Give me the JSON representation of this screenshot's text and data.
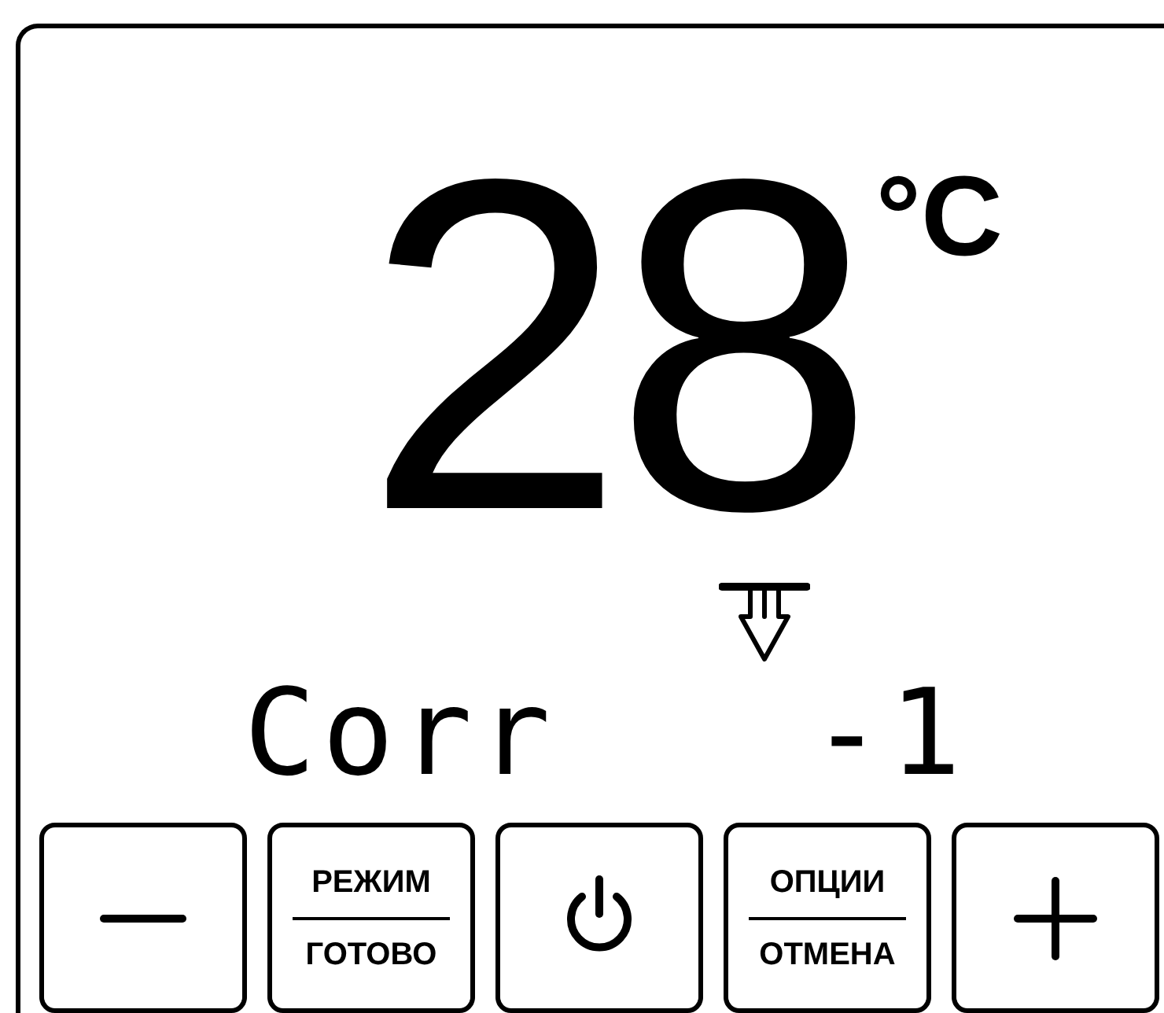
{
  "temperature": {
    "value": "28",
    "unit": "°C"
  },
  "status_line": {
    "label": "Corr",
    "value": "-1"
  },
  "buttons": [
    {
      "kind": "minus"
    },
    {
      "kind": "dual",
      "top": "РЕЖИМ",
      "bottom": "ГОТОВО"
    },
    {
      "kind": "power"
    },
    {
      "kind": "dual",
      "top": "ОПЦИИ",
      "bottom": "ОТМЕНА"
    },
    {
      "kind": "plus"
    }
  ]
}
